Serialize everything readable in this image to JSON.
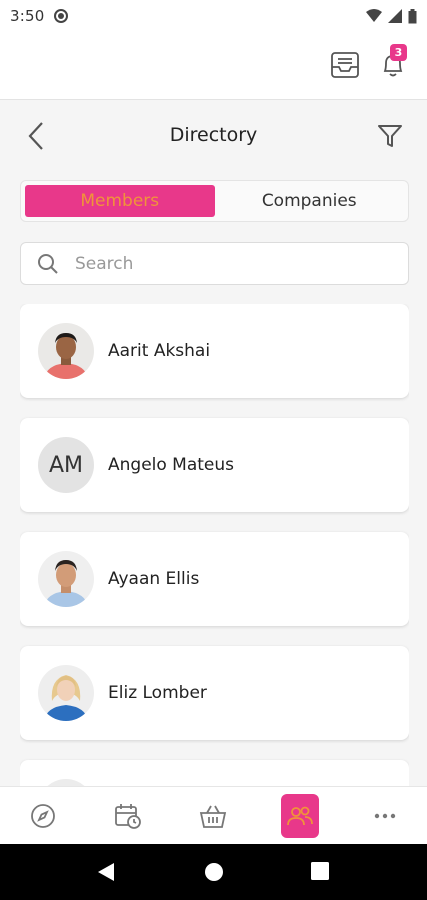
{
  "status_bar": {
    "time": "3:50"
  },
  "app_bar": {
    "notification_count": "3"
  },
  "header": {
    "title": "Directory"
  },
  "tabs": [
    {
      "label": "Members",
      "active": true
    },
    {
      "label": "Companies",
      "active": false
    }
  ],
  "search": {
    "placeholder": "Search",
    "value": ""
  },
  "members": [
    {
      "name": "Aarit Akshai",
      "avatar": "photo",
      "initials": ""
    },
    {
      "name": "Angelo Mateus",
      "avatar": "initials",
      "initials": "AM"
    },
    {
      "name": "Ayaan Ellis",
      "avatar": "photo",
      "initials": ""
    },
    {
      "name": "Eliz Lomber",
      "avatar": "photo",
      "initials": ""
    }
  ],
  "bottom_nav": [
    {
      "icon": "compass-icon",
      "active": false
    },
    {
      "icon": "calendar-clock-icon",
      "active": false
    },
    {
      "icon": "basket-icon",
      "active": false
    },
    {
      "icon": "people-icon",
      "active": true
    },
    {
      "icon": "more-dots-icon",
      "active": false
    }
  ],
  "colors": {
    "accent": "#e8388a",
    "accent_text": "#f0933a"
  }
}
